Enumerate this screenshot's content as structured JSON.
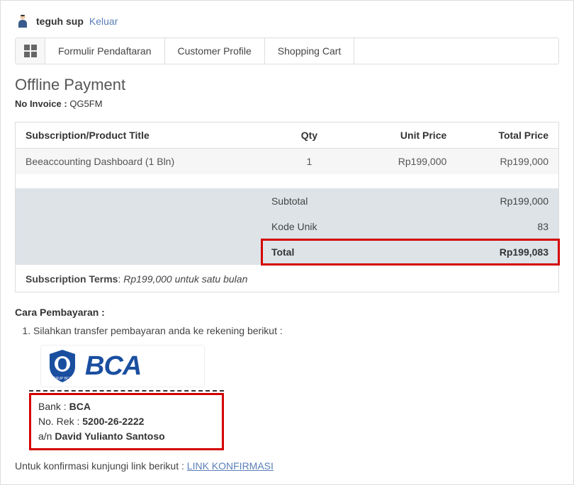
{
  "user": {
    "name": "teguh sup",
    "logout": "Keluar"
  },
  "tabs": {
    "t1": "Formulir Pendaftaran",
    "t2": "Customer Profile",
    "t3": "Shopping Cart"
  },
  "page": {
    "title": "Offline Payment",
    "invoice_label": "No Invoice :",
    "invoice_no": "QG5FM"
  },
  "table": {
    "col_title": "Subscription/Product Title",
    "col_qty": "Qty",
    "col_unit": "Unit Price",
    "col_total": "Total Price",
    "item": {
      "title": "Beeaccounting Dashboard (1 Bln)",
      "qty": "1",
      "unit": "Rp199,000",
      "total": "Rp199,000"
    },
    "subtotal_label": "Subtotal",
    "subtotal_value": "Rp199,000",
    "kode_label": "Kode Unik",
    "kode_value": "83",
    "total_label": "Total",
    "total_value": "Rp199,083",
    "terms_label": "Subscription Terms",
    "terms_value": "Rp199,000 untuk satu bulan"
  },
  "payment": {
    "heading": "Cara Pembayaran :",
    "step1": "Silahkan transfer pembayaran anda ke rekening berikut :",
    "bank_logo_text": "BCA",
    "bank_label": "Bank :",
    "bank_value": "BCA",
    "rek_label": "No. Rek :",
    "rek_value": "5200-26-2222",
    "an_label": "a/n",
    "an_value": "David Yulianto Santoso",
    "confirm_text": "Untuk konfirmasi kunjungi link berikut :",
    "confirm_link": "LINK KONFIRMASI"
  }
}
